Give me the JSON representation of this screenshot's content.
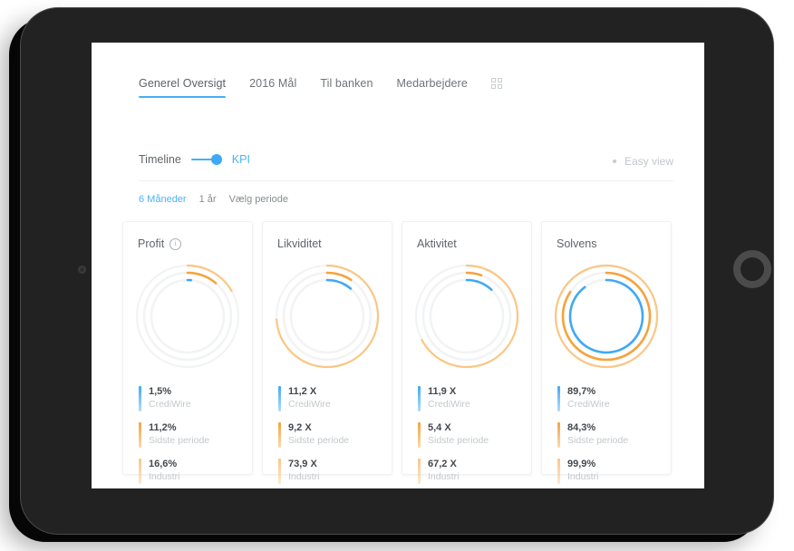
{
  "nav": {
    "tabs": [
      {
        "label": "Generel Oversigt",
        "active": true
      },
      {
        "label": "2016 Mål",
        "active": false
      },
      {
        "label": "Til banken",
        "active": false
      },
      {
        "label": "Medarbejdere",
        "active": false
      }
    ],
    "grid_icon": "grid-icon"
  },
  "toggle": {
    "left_label": "Timeline",
    "right_label": "KPI",
    "state": "KPI",
    "accent": "#3fa9f5"
  },
  "easy_view": {
    "label": "Easy view",
    "dot_color": "#c7cbce"
  },
  "period": {
    "options": [
      {
        "label": "6 Måneder",
        "active": true
      },
      {
        "label": "1 år",
        "active": false
      },
      {
        "label": "Vælg periode",
        "active": false
      }
    ]
  },
  "colors": {
    "crediwire": "#3fa9f5",
    "sidste_periode": "#f5a33c",
    "industri": "#fbc684",
    "track": "#f2f3f4",
    "accent": "#46b0f5",
    "text": "#5f6569",
    "muted": "#c3c8cb"
  },
  "chart_data": [
    {
      "type": "pie",
      "title": "Profit",
      "unit": "%",
      "has_info_icon": true,
      "series": [
        {
          "name": "CrediWire",
          "value": 1.5,
          "display": "1,5%",
          "color": "#3fa9f5",
          "ring": "inner",
          "fraction": 0.015
        },
        {
          "name": "Sidste periode",
          "value": 11.2,
          "display": "11,2%",
          "color": "#f5a33c",
          "ring": "middle",
          "fraction": 0.112
        },
        {
          "name": "Industri",
          "value": 16.6,
          "display": "16,6%",
          "color": "#fbc684",
          "ring": "outer",
          "fraction": 0.166
        }
      ]
    },
    {
      "type": "pie",
      "title": "Likviditet",
      "unit": "X",
      "has_info_icon": false,
      "series": [
        {
          "name": "CrediWire",
          "value": 11.2,
          "display": "11,2 X",
          "color": "#3fa9f5",
          "ring": "inner",
          "fraction": 0.112
        },
        {
          "name": "Sidste periode",
          "value": 9.2,
          "display": "9,2 X",
          "color": "#f5a33c",
          "ring": "middle",
          "fraction": 0.092
        },
        {
          "name": "Industri",
          "value": 73.9,
          "display": "73,9 X",
          "color": "#fbc684",
          "ring": "outer",
          "fraction": 0.739
        }
      ]
    },
    {
      "type": "pie",
      "title": "Aktivitet",
      "unit": "X",
      "has_info_icon": false,
      "series": [
        {
          "name": "CrediWire",
          "value": 11.9,
          "display": "11,9 X",
          "color": "#3fa9f5",
          "ring": "inner",
          "fraction": 0.119
        },
        {
          "name": "Sidste periode",
          "value": 5.4,
          "display": "5,4 X",
          "color": "#f5a33c",
          "ring": "middle",
          "fraction": 0.054
        },
        {
          "name": "Industri",
          "value": 67.2,
          "display": "67,2 X",
          "color": "#fbc684",
          "ring": "outer",
          "fraction": 0.672
        }
      ]
    },
    {
      "type": "pie",
      "title": "Solvens",
      "unit": "%",
      "has_info_icon": false,
      "series": [
        {
          "name": "CrediWire",
          "value": 89.7,
          "display": "89,7%",
          "color": "#3fa9f5",
          "ring": "inner",
          "fraction": 0.897
        },
        {
          "name": "Sidste periode",
          "value": 84.3,
          "display": "84,3%",
          "color": "#f5a33c",
          "ring": "middle",
          "fraction": 0.843
        },
        {
          "name": "Industri",
          "value": 99.9,
          "display": "99,9%",
          "color": "#fbc684",
          "ring": "outer",
          "fraction": 0.999
        }
      ]
    }
  ]
}
